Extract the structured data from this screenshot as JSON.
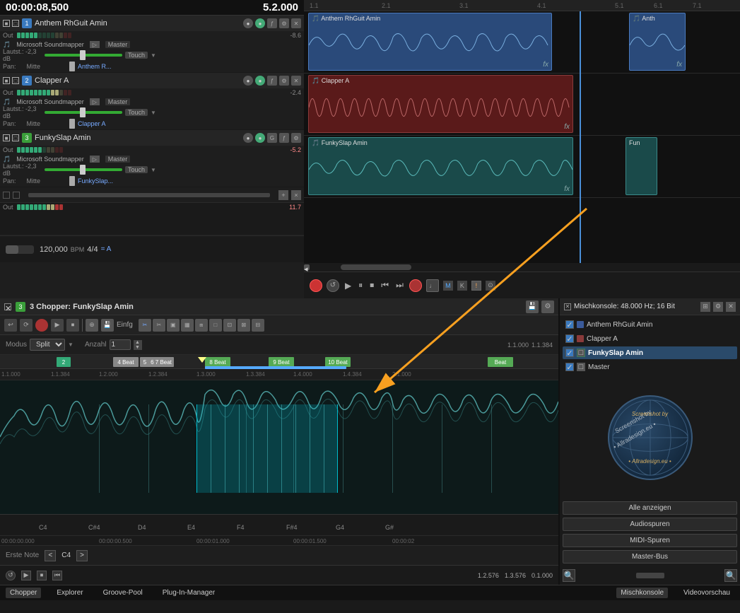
{
  "header": {
    "time": "00:00:08,500",
    "position": "5.2.000"
  },
  "tracks": [
    {
      "id": 1,
      "number": "1",
      "name": "Anthem RhGuit Amin",
      "color": "#2a4a7a",
      "clip_color": "blue",
      "out_label": "Out",
      "soundmapper": "Microsoft Soundmapper",
      "master": "Master",
      "volume": "Lautst.: -2,3 dB",
      "pan": "Pan:",
      "pan_val": "Mitte",
      "automation": "Anthem R...",
      "db_val": "-8.6",
      "mode": "Touch"
    },
    {
      "id": 2,
      "number": "2",
      "name": "Clapper A",
      "color": "#7a2a2a",
      "clip_color": "red",
      "out_label": "Out",
      "soundmapper": "Microsoft Soundmapper",
      "master": "Master",
      "volume": "Lautst.: -2,3 dB",
      "pan": "Pan:",
      "pan_val": "Mitte",
      "automation": "Clapper A",
      "db_val": "-2.4",
      "mode": "Touch"
    },
    {
      "id": 3,
      "number": "3",
      "name": "FunkySlap Amin",
      "color": "#2a6a4a",
      "clip_color": "teal",
      "out_label": "Out",
      "soundmapper": "Microsoft Soundmapper",
      "master": "Master",
      "volume": "Lautst.: -2,3 dB",
      "pan": "Pan:",
      "pan_val": "Mitte",
      "automation": "FunkySlap...",
      "db_val": "-5.2",
      "mode": "Touch"
    }
  ],
  "empty_track": {
    "db_val": "11.7"
  },
  "transport": {
    "bpm": "120,000",
    "bpm_label": "BPM",
    "time_sig": "4/4",
    "sync_label": "= A"
  },
  "chopper": {
    "title": "3 Chopper: FunkySlap Amin",
    "mode_label": "Modus",
    "mode_value": "Split",
    "count_label": "Anzahl",
    "count_value": "1",
    "toolbar_label": "Einfg",
    "position_start": "1.1.000",
    "position_end": "1.1.384",
    "note_label": "Erste Note",
    "note_value": "C4",
    "time_start": "00:00:00.000",
    "time_mid1": "00:00:00.500",
    "time_mid2": "00:00:01.000",
    "time_mid3": "00:00:01.500",
    "time_end": "00:00:02",
    "pos_bottom1": "1.2.576",
    "pos_bottom2": "1.3.576",
    "pos_bottom3": "0.1.000"
  },
  "mixer": {
    "title": "Mischkonsole: 48.000 Hz; 16 Bit",
    "tracks": [
      {
        "name": "Anthem RhGuit Amin",
        "color": "#3a5a9a",
        "checked": true
      },
      {
        "name": "Clapper A",
        "color": "#8a3a3a",
        "checked": true
      },
      {
        "name": "FunkySlap Amin",
        "color": "#3a7a5a",
        "checked": true,
        "selected": true
      },
      {
        "name": "Master",
        "color": "#5a5a5a",
        "checked": true
      }
    ],
    "show_all": "Alle anzeigen",
    "audio_tracks": "Audiospuren",
    "midi_tracks": "MIDI-Spuren",
    "master_bus": "Master-Bus"
  },
  "bottom_tabs": [
    {
      "label": "Chopper",
      "active": true
    },
    {
      "label": "Explorer",
      "active": false
    },
    {
      "label": "Groove-Pool",
      "active": false
    },
    {
      "label": "Plug-In-Manager",
      "active": false
    }
  ],
  "bottom_right_tabs": [
    {
      "label": "Mischkonsole",
      "active": true
    },
    {
      "label": "Videovorschau",
      "active": false
    }
  ],
  "ruler_marks": [
    "1.1",
    "2.1",
    "3.1",
    "4.1",
    "5.1",
    "6.1",
    "7.1"
  ],
  "beat_markers": [
    "2",
    "4 Beat",
    "5 Beat",
    "6 7 Beat",
    "8 Beat",
    "9 Beat",
    "10 Beat",
    "Beat"
  ],
  "note_labels": [
    "C4",
    "C#4",
    "D4",
    "E4",
    "F4",
    "F#4",
    "G4",
    "G#"
  ],
  "chopper_ruler_marks": [
    "1.1.000",
    "1.1.384",
    "1.2.000",
    "1.2.384",
    "1.3.000",
    "1.3.384",
    "1.4.000",
    "1.4.384",
    "2.1.000"
  ]
}
